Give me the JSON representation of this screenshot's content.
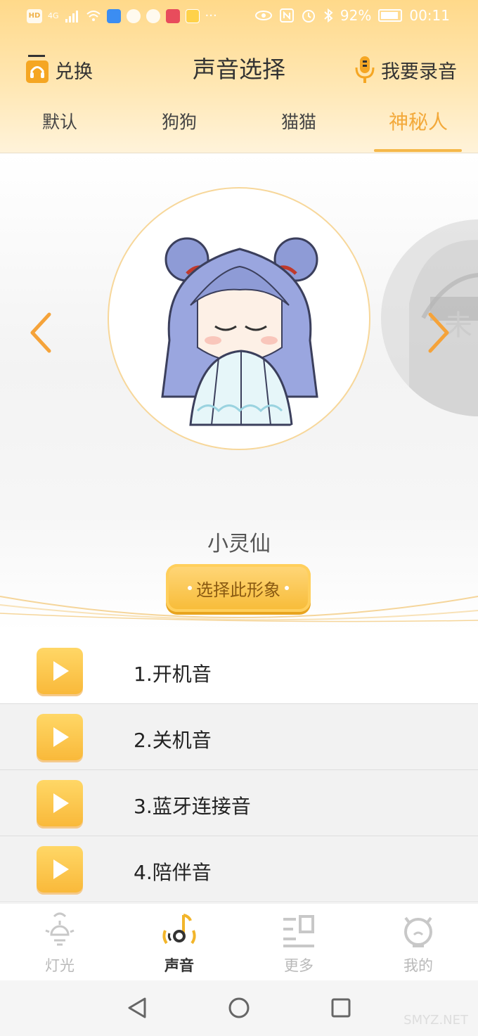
{
  "status_bar": {
    "battery": "92%",
    "time": "00:11",
    "network": "4G"
  },
  "header": {
    "exchange_label": "兑换",
    "title": "声音选择",
    "record_label": "我要录音"
  },
  "tabs": [
    {
      "label": "默认",
      "active": false
    },
    {
      "label": "狗狗",
      "active": false
    },
    {
      "label": "猫猫",
      "active": false
    },
    {
      "label": "神秘人",
      "active": true
    }
  ],
  "character": {
    "name": "小灵仙",
    "select_button": "选择此形象",
    "next_preview_text": "未"
  },
  "sounds": [
    {
      "label": "1.开机音"
    },
    {
      "label": "2.关机音"
    },
    {
      "label": "3.蓝牙连接音"
    },
    {
      "label": "4.陪伴音"
    }
  ],
  "bottom_nav": [
    {
      "label": "灯光",
      "icon": "light-icon",
      "active": false
    },
    {
      "label": "声音",
      "icon": "sound-icon",
      "active": true
    },
    {
      "label": "更多",
      "icon": "more-icon",
      "active": false
    },
    {
      "label": "我的",
      "icon": "profile-icon",
      "active": false
    }
  ],
  "watermark": "SMYZ.NET",
  "colors": {
    "accent": "#f3a93a",
    "header_bg": "#ffd98a",
    "play_button": "#f9b93a"
  }
}
